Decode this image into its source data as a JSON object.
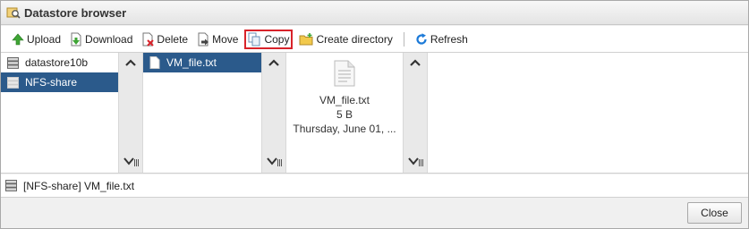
{
  "window": {
    "title": "Datastore browser"
  },
  "toolbar": {
    "upload_label": "Upload",
    "download_label": "Download",
    "delete_label": "Delete",
    "move_label": "Move",
    "copy_label": "Copy",
    "create_directory_label": "Create directory",
    "refresh_label": "Refresh",
    "highlighted_button": "Copy"
  },
  "datastores": {
    "items": [
      {
        "label": "datastore10b",
        "selected": false
      },
      {
        "label": "NFS-share",
        "selected": true
      }
    ]
  },
  "files": {
    "items": [
      {
        "label": "VM_file.txt",
        "selected": true
      }
    ]
  },
  "preview": {
    "name": "VM_file.txt",
    "size": "5 B",
    "modified": "Thursday, June 01, ..."
  },
  "status": {
    "path": "[NFS-share] VM_file.txt"
  },
  "footer": {
    "close_label": "Close"
  },
  "colors": {
    "selection": "#2b5a8b",
    "highlight_border": "#d8232a",
    "refresh_icon": "#1c7ad8",
    "upload_icon": "#3fa535",
    "folder_icon": "#f2c94c"
  }
}
